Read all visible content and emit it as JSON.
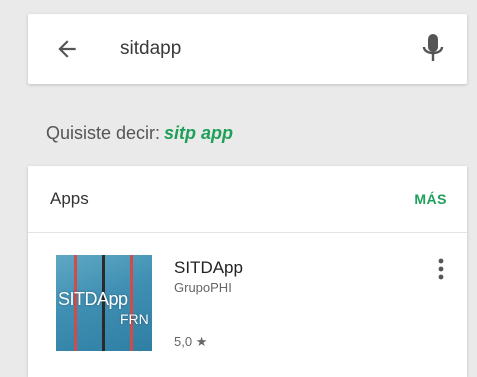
{
  "search": {
    "query": "sitdapp",
    "back_icon": "arrow-left-icon",
    "mic_icon": "microphone-icon"
  },
  "suggestion": {
    "prefix": "Quisiste decir:",
    "link": "sitp app"
  },
  "apps_section": {
    "title": "Apps",
    "more_label": "MÁS",
    "items": [
      {
        "name": "SITDApp",
        "developer": "GrupoPHI",
        "rating": "5,0",
        "icon_text_1": "SITDApp",
        "icon_text_2": "FRN",
        "menu_icon": "more-vert-icon"
      }
    ]
  },
  "colors": {
    "accent": "#1fa05a",
    "background": "#eaeaea",
    "card": "#ffffff"
  }
}
